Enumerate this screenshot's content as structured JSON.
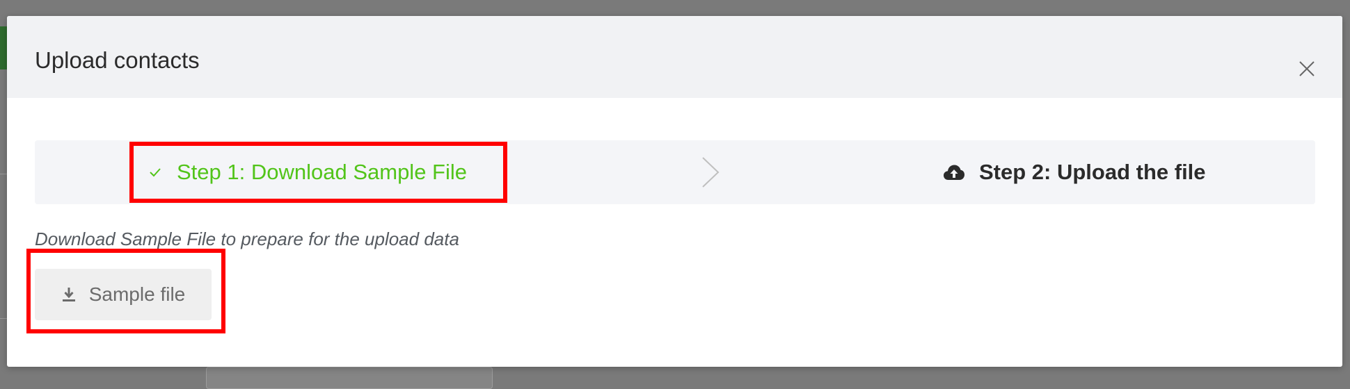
{
  "modal": {
    "title": "Upload contacts"
  },
  "steps": {
    "step1_label": "Step 1: Download Sample File",
    "step2_label": "Step 2: Upload the file"
  },
  "content": {
    "description": "Download Sample File to prepare for the upload data",
    "sample_button_label": "Sample file"
  },
  "icons": {
    "close": "close-icon",
    "step1": "check-icon",
    "separator": "chevron-right-icon",
    "step2": "cloud-upload-icon",
    "sample": "download-icon"
  },
  "colors": {
    "step_done": "#52c41a",
    "highlight": "#ff0000",
    "header_bg": "#f1f2f4",
    "overlay": "#7a7a7a"
  }
}
